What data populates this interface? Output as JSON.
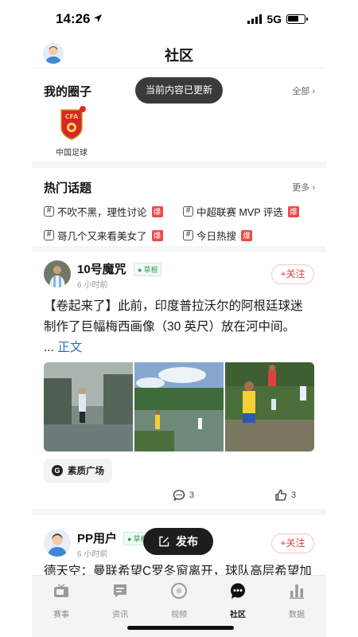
{
  "status": {
    "time": "14:26",
    "network": "5G",
    "battery_level": 0.7
  },
  "header": {
    "title": "社区"
  },
  "toast": {
    "text": "当前内容已更新"
  },
  "circles": {
    "title": "我的圈子",
    "more": "全部",
    "items": [
      {
        "name": "中国足球",
        "has_unread": true,
        "logo_text": "CFA"
      }
    ]
  },
  "topics": {
    "title": "热门话题",
    "more": "更多",
    "hot_label": "爆",
    "items": [
      {
        "label": "不吹不黑，理性讨论"
      },
      {
        "label": "中超联赛 MVP 评选"
      },
      {
        "label": "哥几个又来看美女了"
      },
      {
        "label": "今日热搜"
      }
    ]
  },
  "posts": [
    {
      "user": "10号魔咒",
      "badge": "草根",
      "time": "6 小时前",
      "follow": "+关注",
      "text": "【卷起来了】此前，印度普拉沃尔的阿根廷球迷制作了巨幅梅西画像（30 英尺）放在河中间。",
      "ellipsis": "...",
      "read_more": "正文",
      "tag": "素质广场",
      "comments": "3",
      "likes": "3"
    },
    {
      "user": "PP用户",
      "badge": "草根",
      "time": "6 小时前",
      "follow": "+关注",
      "text": "德天空：曼联希望C罗冬窗离开，球队高层希望加"
    }
  ],
  "publish": {
    "label": "发布"
  },
  "tabbar": {
    "items": [
      {
        "label": "赛事",
        "icon": "tv-icon",
        "active": false
      },
      {
        "label": "资讯",
        "icon": "news-icon",
        "active": false
      },
      {
        "label": "视频",
        "icon": "play-icon",
        "active": false
      },
      {
        "label": "社区",
        "icon": "chat-bubble-icon",
        "active": true
      },
      {
        "label": "数据",
        "icon": "bar-chart-icon",
        "active": false
      }
    ]
  },
  "colors": {
    "accent_red": "#e03a3a",
    "link_blue": "#2d6cc2",
    "badge_green": "#31a452"
  }
}
